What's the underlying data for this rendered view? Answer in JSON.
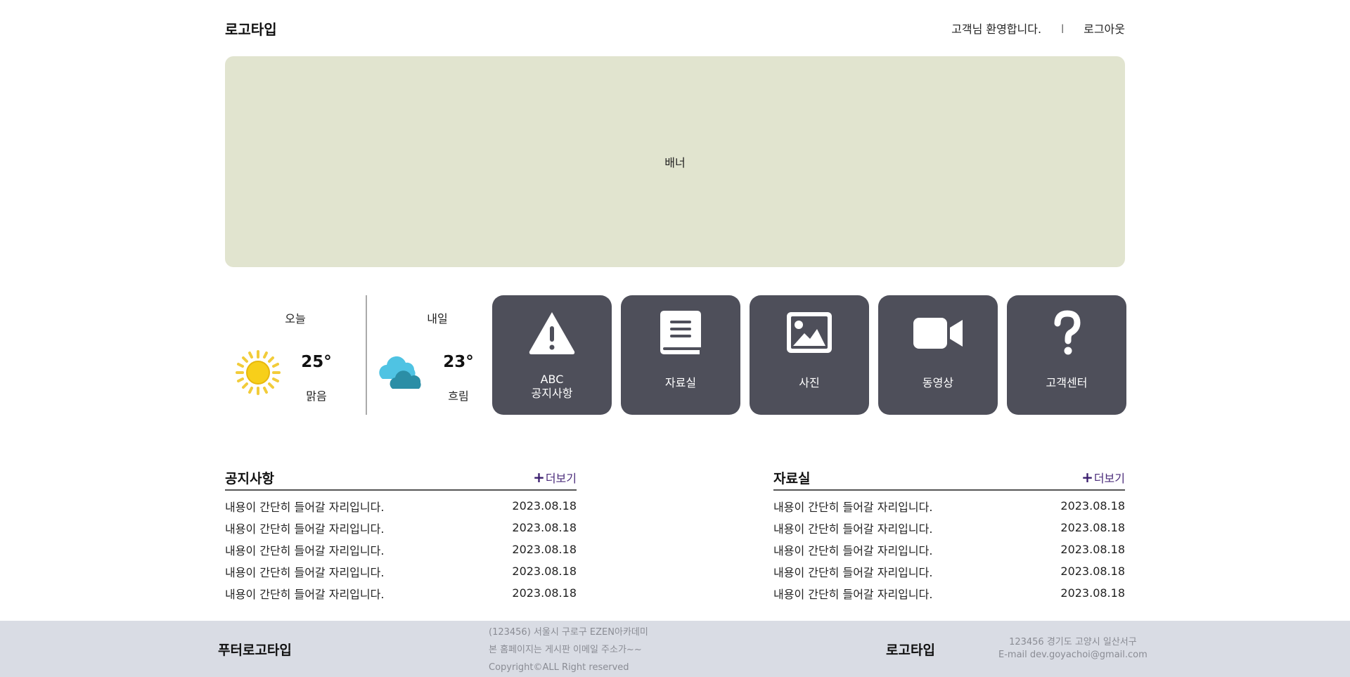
{
  "header": {
    "logo": "로고타입",
    "welcome": "고객님 환영합니다.",
    "separator": "|",
    "logout": "로그아웃"
  },
  "banner": {
    "label": "배너"
  },
  "weather": [
    {
      "title": "오늘",
      "icon": "sun-icon",
      "temp": "25°",
      "desc": "맑음"
    },
    {
      "title": "내일",
      "icon": "cloud-icon",
      "temp": "23°",
      "desc": "흐림"
    }
  ],
  "tiles": [
    {
      "icon": "warning-icon",
      "line1": "ABC",
      "line2": "공지사항"
    },
    {
      "icon": "book-icon",
      "label": "자료실"
    },
    {
      "icon": "image-icon",
      "label": "사진"
    },
    {
      "icon": "video-icon",
      "label": "동영상"
    },
    {
      "icon": "question-icon",
      "label": "고객센터"
    }
  ],
  "boards": [
    {
      "title": "공지사항",
      "more_plus": "+",
      "more": "더보기",
      "items": [
        {
          "text": "내용이 간단히 들어갈 자리입니다.",
          "date": "2023.08.18"
        },
        {
          "text": "내용이 간단히 들어갈 자리입니다.",
          "date": "2023.08.18"
        },
        {
          "text": "내용이 간단히 들어갈 자리입니다.",
          "date": "2023.08.18"
        },
        {
          "text": "내용이 간단히 들어갈 자리입니다.",
          "date": "2023.08.18"
        },
        {
          "text": "내용이 간단히 들어갈 자리입니다.",
          "date": "2023.08.18"
        }
      ]
    },
    {
      "title": "자료실",
      "more_plus": "+",
      "more": "더보기",
      "items": [
        {
          "text": "내용이 간단히 들어갈 자리입니다.",
          "date": "2023.08.18"
        },
        {
          "text": "내용이 간단히 들어갈 자리입니다.",
          "date": "2023.08.18"
        },
        {
          "text": "내용이 간단히 들어갈 자리입니다.",
          "date": "2023.08.18"
        },
        {
          "text": "내용이 간단히 들어갈 자리입니다.",
          "date": "2023.08.18"
        },
        {
          "text": "내용이 간단히 들어갈 자리입니다.",
          "date": "2023.08.18"
        }
      ]
    }
  ],
  "footer": {
    "logo_left": "푸터로고타입",
    "info_line1": "(123456) 서울시 구로구 EZEN아카데미",
    "info_line2": "본 홈페이지는 게시판 이메일 주소가~~",
    "info_line3": "Copyright©ALL Right reserved",
    "logo_right": "로고타입",
    "addr_line1": "123456 경기도 고양시 일산서구",
    "addr_line2": "E-mail dev.goyachoi@gmail.com"
  },
  "colors": {
    "banner_bg": "#e1e4cf",
    "tile_bg": "#4e4f5a",
    "footer_bg": "#d9dce4",
    "more_accent": "#3a1d6e"
  }
}
